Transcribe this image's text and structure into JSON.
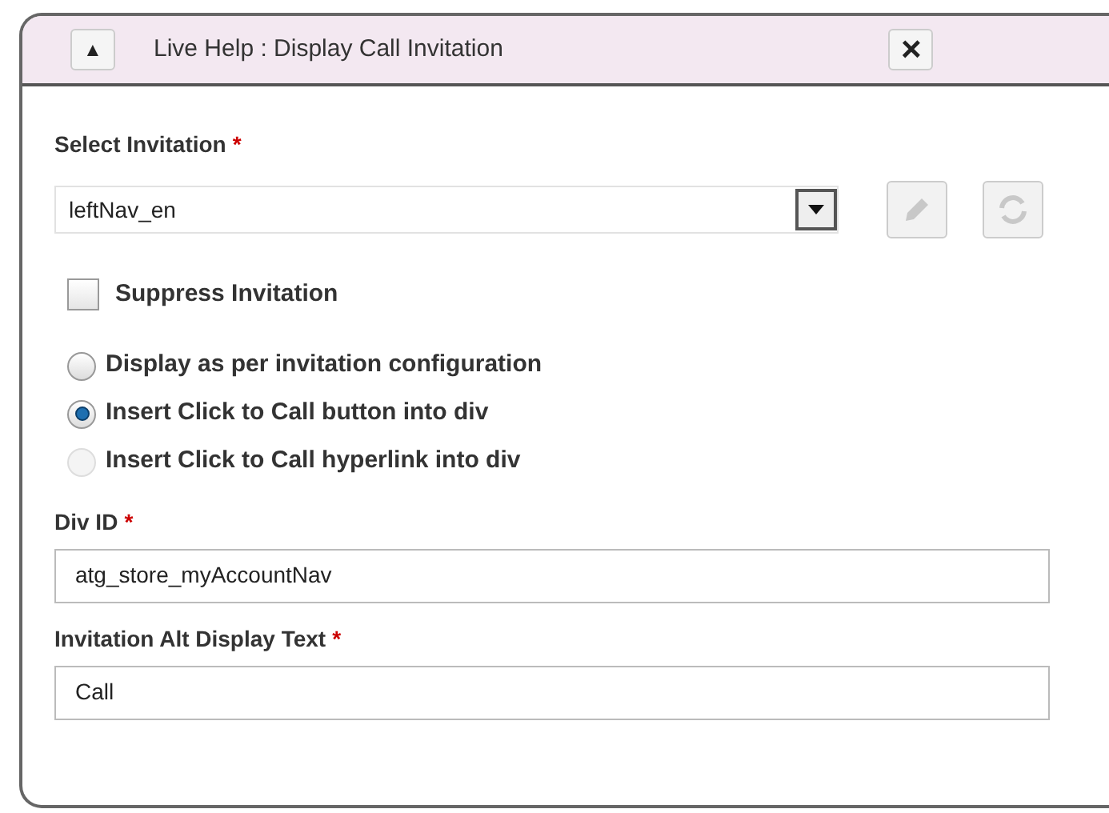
{
  "window": {
    "title": "Live Help : Display Call Invitation",
    "collapse_icon": "▲",
    "close_icon": "×"
  },
  "select_invitation": {
    "label": "Select Invitation",
    "required_mark": "*",
    "value": "leftNav_en",
    "edit_disabled": true,
    "refresh_disabled": true
  },
  "suppress_invitation": {
    "label": "Suppress Invitation",
    "checked": false
  },
  "display_options": [
    {
      "label": "Display as per invitation configuration",
      "selected": false,
      "disabled": false
    },
    {
      "label": "Insert Click to Call button into div",
      "selected": true,
      "disabled": false
    },
    {
      "label": "Insert Click to Call hyperlink into div",
      "selected": false,
      "disabled": true
    }
  ],
  "fields": [
    {
      "label": "Div ID",
      "required_mark": "*",
      "value": "atg_store_myAccountNav"
    },
    {
      "label": "Invitation Alt Display Text",
      "required_mark": "*",
      "value": "Call"
    }
  ]
}
